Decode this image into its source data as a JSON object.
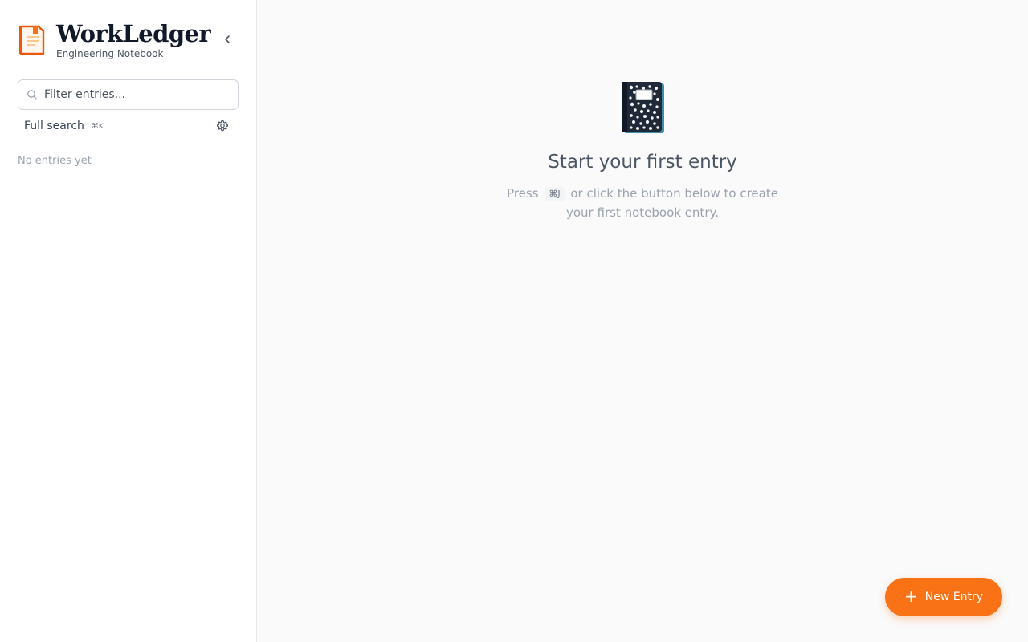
{
  "colors": {
    "accent": "#f97316",
    "background": "#fafafa",
    "sidebar_bg": "#ffffff",
    "border": "#e5e7eb"
  },
  "sidebar": {
    "brand": {
      "title": "WorkLedger",
      "subtitle": "Engineering Notebook",
      "logo_icon": "notebook-logo-icon"
    },
    "collapse_icon": "chevron-left-icon",
    "filter": {
      "placeholder": "Filter entries...",
      "value": "",
      "icon": "search-icon"
    },
    "full_search": {
      "label": "Full search",
      "shortcut": "⌘K"
    },
    "settings_icon": "gear-icon",
    "empty_text": "No entries yet"
  },
  "main": {
    "empty_state": {
      "icon": "notebook-icon",
      "title": "Start your first entry",
      "desc_before": "Press",
      "shortcut": "⌘J",
      "desc_after": "or click the button below to create your first notebook entry."
    },
    "new_entry_button": {
      "icon": "plus",
      "label": "New Entry"
    }
  }
}
